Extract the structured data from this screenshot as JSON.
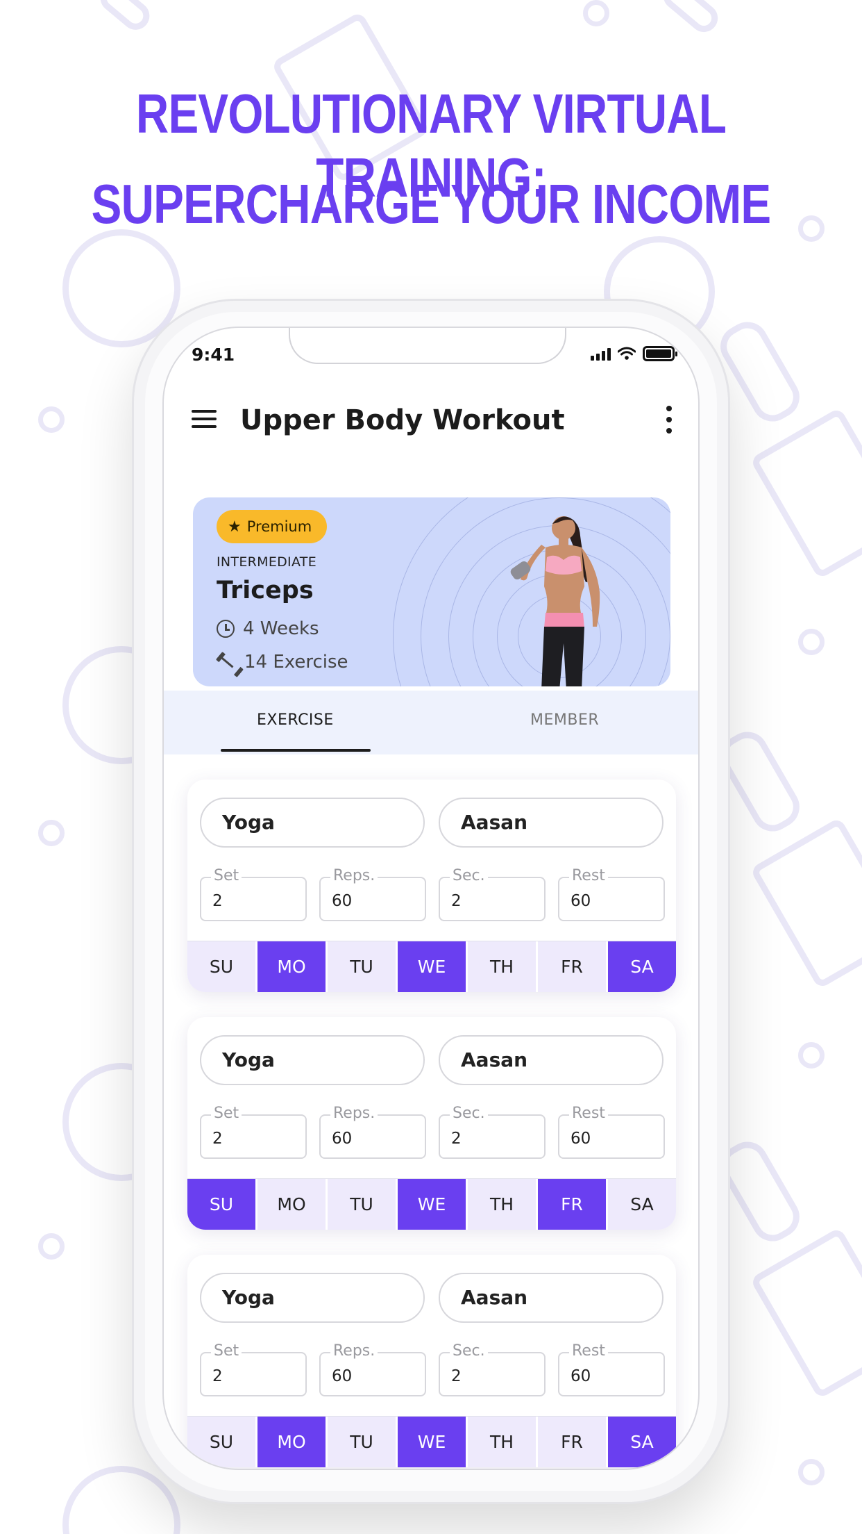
{
  "headline": {
    "line1": "REVOLUTIONARY VIRTUAL TRAINING:",
    "line2": "SUPERCHARGE YOUR INCOME"
  },
  "status_bar": {
    "time": "9:41"
  },
  "app_bar": {
    "title": "Upper Body Workout"
  },
  "banner": {
    "badge": "Premium",
    "level": "INTERMEDIATE",
    "program": "Triceps",
    "duration": "4 Weeks",
    "exercise_count": "14 Exercise"
  },
  "tabs": [
    {
      "label": "EXERCISE",
      "active": true
    },
    {
      "label": "MEMBER",
      "active": false
    }
  ],
  "field_labels": {
    "set": "Set",
    "reps": "Reps.",
    "sec": "Sec.",
    "rest": "Rest"
  },
  "exercises": [
    {
      "name": "Yoga",
      "type": "Aasan",
      "set": "2",
      "reps": "60",
      "sec": "2",
      "rest": "60",
      "days": [
        {
          "label": "SU",
          "on": false
        },
        {
          "label": "MO",
          "on": true
        },
        {
          "label": "TU",
          "on": false
        },
        {
          "label": "WE",
          "on": true
        },
        {
          "label": "TH",
          "on": false
        },
        {
          "label": "FR",
          "on": false
        },
        {
          "label": "SA",
          "on": true
        }
      ]
    },
    {
      "name": "Yoga",
      "type": "Aasan",
      "set": "2",
      "reps": "60",
      "sec": "2",
      "rest": "60",
      "days": [
        {
          "label": "SU",
          "on": true
        },
        {
          "label": "MO",
          "on": false
        },
        {
          "label": "TU",
          "on": false
        },
        {
          "label": "WE",
          "on": true
        },
        {
          "label": "TH",
          "on": false
        },
        {
          "label": "FR",
          "on": true
        },
        {
          "label": "SA",
          "on": false
        }
      ]
    },
    {
      "name": "Yoga",
      "type": "Aasan",
      "set": "2",
      "reps": "60",
      "sec": "2",
      "rest": "60",
      "days": [
        {
          "label": "SU",
          "on": false
        },
        {
          "label": "MO",
          "on": true
        },
        {
          "label": "TU",
          "on": false
        },
        {
          "label": "WE",
          "on": true
        },
        {
          "label": "TH",
          "on": false
        },
        {
          "label": "FR",
          "on": false
        },
        {
          "label": "SA",
          "on": true
        }
      ]
    }
  ],
  "colors": {
    "accent": "#6a3ff0",
    "day_off": "#eeeafc",
    "banner": "#cdd8fb",
    "badge": "#f9b92a"
  },
  "icons": {
    "menu": "hamburger-menu-icon",
    "more": "more-vertical-icon",
    "premium": "star-icon",
    "duration": "clock-icon",
    "exercises": "dumbbell-icon"
  }
}
